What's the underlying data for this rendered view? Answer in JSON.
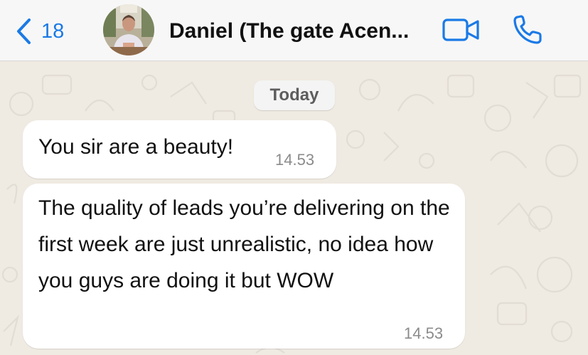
{
  "header": {
    "back_count": "18",
    "contact_name": "Daniel (The gate Acen...",
    "icons": {
      "back": "chevron-left-icon",
      "video": "video-camera-icon",
      "call": "phone-icon"
    },
    "accent_color": "#1a7ae6"
  },
  "chat": {
    "date_label": "Today",
    "messages": [
      {
        "text": "You sir are a beauty!",
        "time": "14.53"
      },
      {
        "text": "The quality of leads you’re delivering on the first week are just unrealistic, no idea how you guys are doing it but WOW",
        "time": "14.53"
      }
    ],
    "background_color": "#efeae2",
    "bubble_color": "#ffffff"
  }
}
